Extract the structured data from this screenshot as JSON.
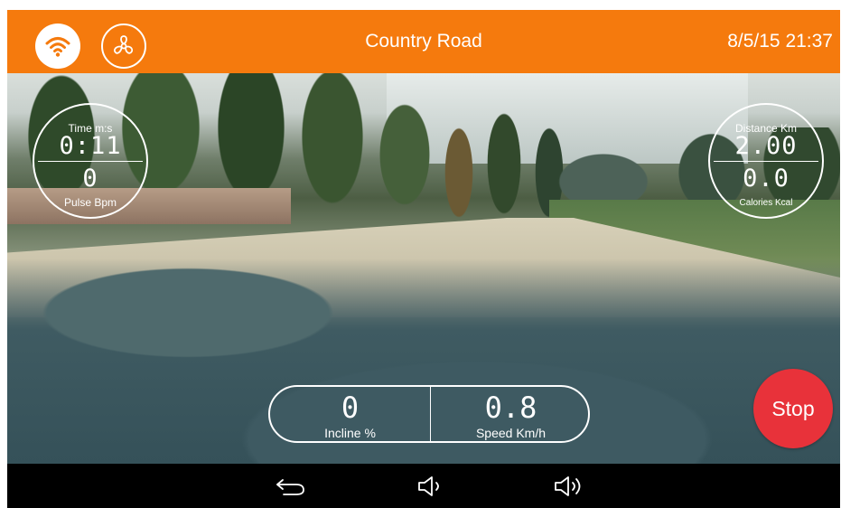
{
  "topbar": {
    "title": "Country Road",
    "datetime": "8/5/15 21:37",
    "wifi_icon": "wifi-icon",
    "fan_icon": "fan-icon",
    "color": "#f57a0d"
  },
  "stats": {
    "time_label": "Time m:s",
    "time_value": "0:11",
    "pulse_value": "0",
    "pulse_label": "Pulse Bpm",
    "distance_label": "Distance Km",
    "distance_value": "2.00",
    "calories_value": "0.0",
    "calories_label": "Calories Kcal",
    "incline_value": "0",
    "incline_label": "Incline %",
    "speed_value": "0.8",
    "speed_label": "Speed Km/h"
  },
  "stop_button": {
    "label": "Stop",
    "color": "#e8323a"
  },
  "navbar": {
    "icons": [
      "back-icon",
      "volume-down-icon",
      "volume-up-icon"
    ]
  }
}
